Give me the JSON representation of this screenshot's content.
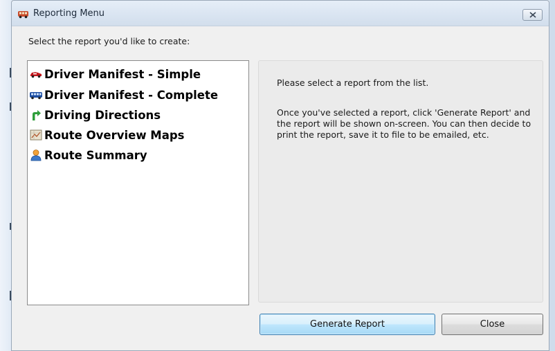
{
  "window": {
    "title": "Reporting Menu",
    "close_label": "Close window"
  },
  "prompt": "Select the report you'd like to create:",
  "reports": [
    {
      "label": "Driver Manifest - Simple",
      "icon": "red-car-icon"
    },
    {
      "label": "Driver Manifest - Complete",
      "icon": "blue-bus-icon"
    },
    {
      "label": "Driving Directions",
      "icon": "green-turn-arrow-icon"
    },
    {
      "label": "Route Overview Maps",
      "icon": "map-icon"
    },
    {
      "label": "Route Summary",
      "icon": "person-icon"
    }
  ],
  "info": {
    "line1": "Please select a report from the list.",
    "line2": "Once you've selected a report, click 'Generate Report' and the report will be shown on-screen. You can then decide to print the report, save it to file to be emailed, etc."
  },
  "buttons": {
    "generate": "Generate Report",
    "close": "Close"
  },
  "colors": {
    "titlebar": "#d9e4f1",
    "primary_button": "#bee6fd",
    "list_bg": "#ffffff",
    "info_bg": "#ebebeb"
  }
}
